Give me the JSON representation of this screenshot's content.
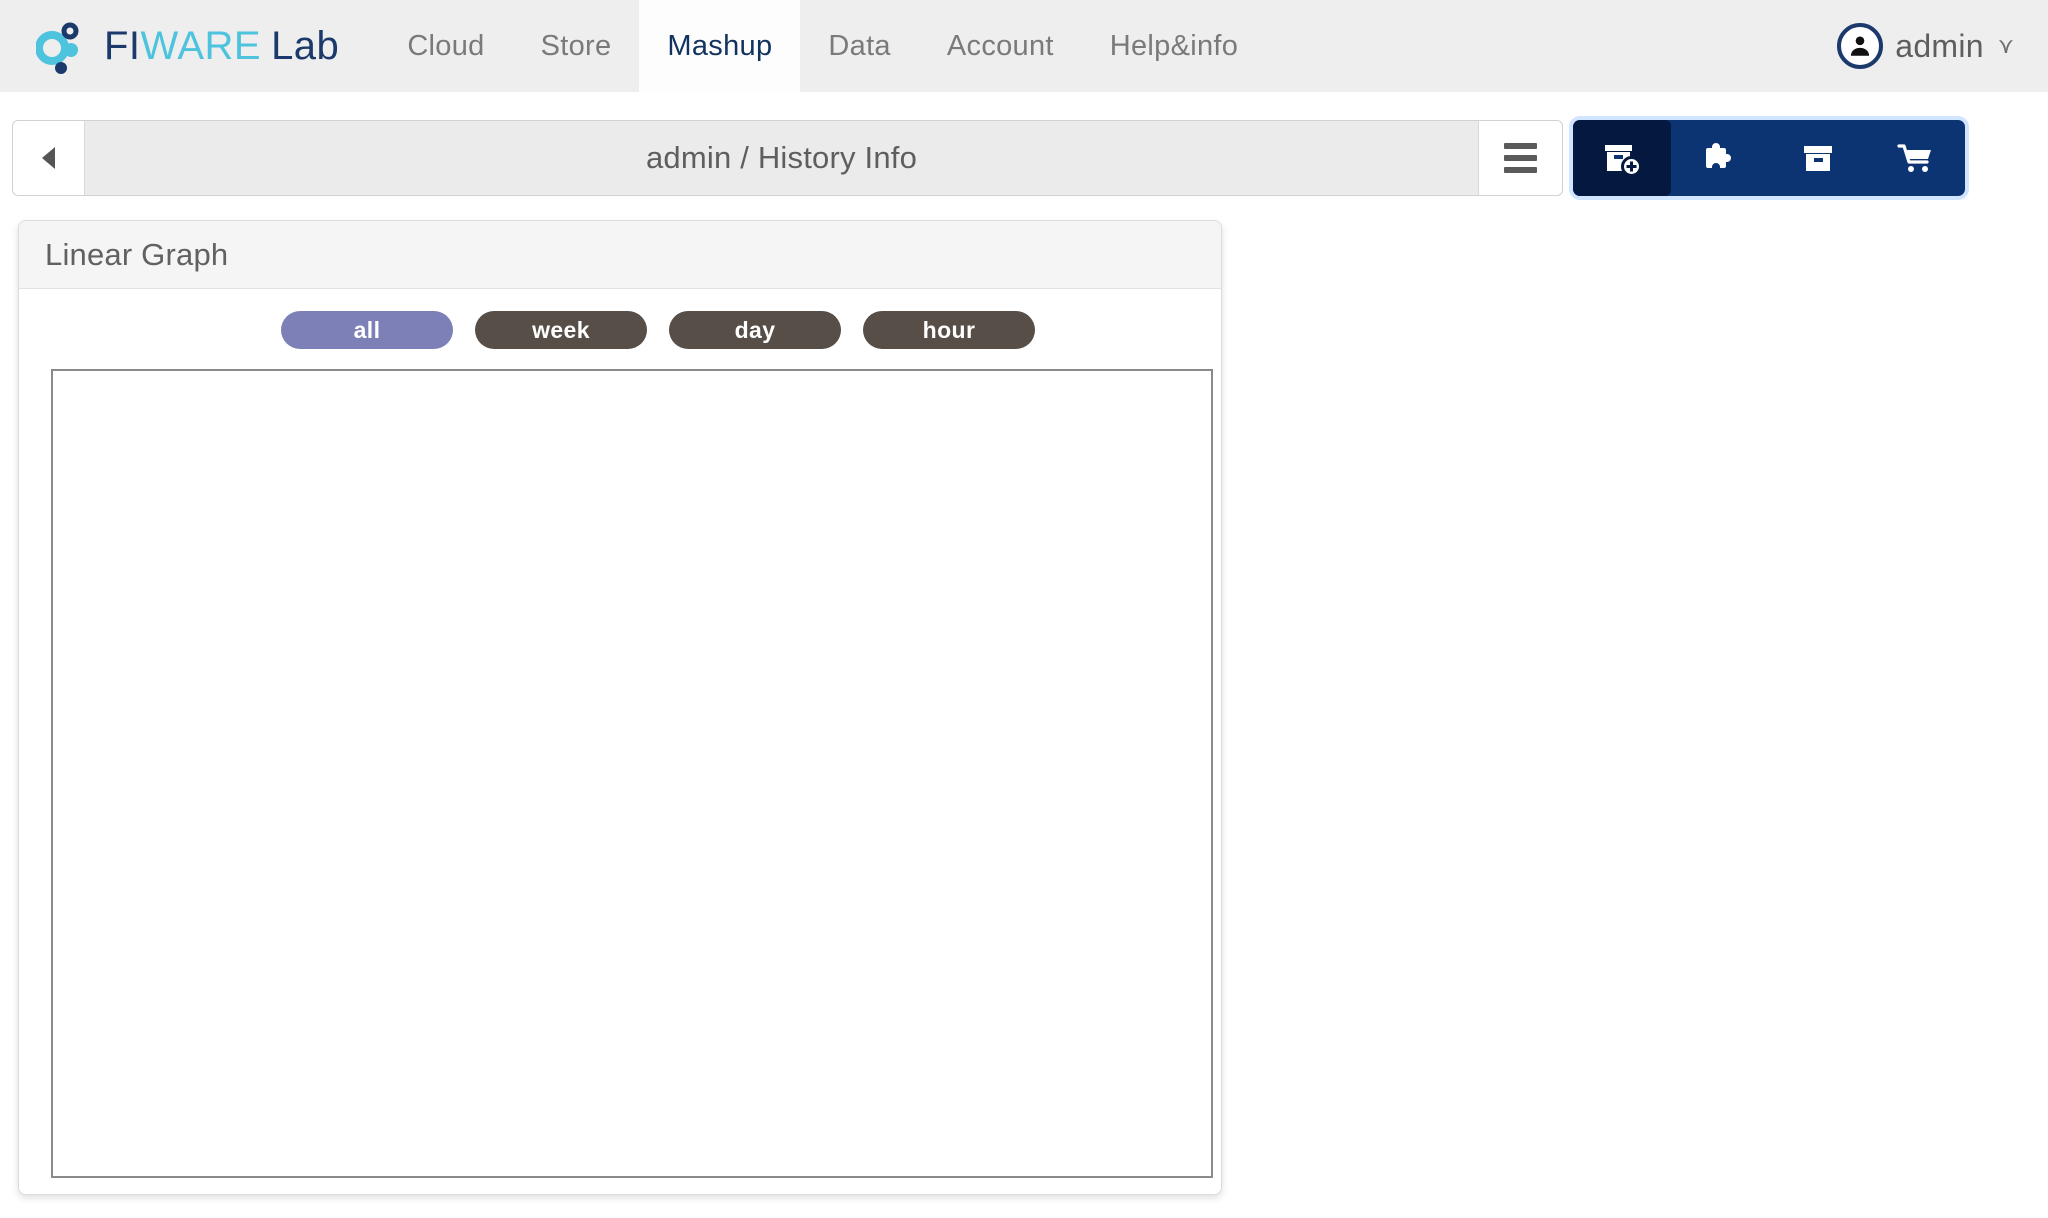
{
  "header": {
    "brand": {
      "fi": "FI",
      "ware": "WARE",
      "lab": "Lab",
      "logo_icon": "fiware-dots-logo"
    },
    "nav": [
      {
        "label": "Cloud",
        "active": false
      },
      {
        "label": "Store",
        "active": false
      },
      {
        "label": "Mashup",
        "active": true
      },
      {
        "label": "Data",
        "active": false
      },
      {
        "label": "Account",
        "active": false
      },
      {
        "label": "Help&info",
        "active": false
      }
    ],
    "user": {
      "name": "admin",
      "avatar_icon": "user-avatar-icon",
      "chevron_icon": "chevron-double-down-icon"
    },
    "background_color": "#eeeeee",
    "active_tab_color": "#12325f"
  },
  "toolbar": {
    "back_icon": "triangle-left-icon",
    "breadcrumb": "admin / History Info",
    "menu_icon": "hamburger-menu-icon",
    "buttons": [
      {
        "name": "new-workspace-button",
        "icon": "box-plus-icon",
        "active": true
      },
      {
        "name": "widgets-button",
        "icon": "puzzle-piece-icon",
        "active": false
      },
      {
        "name": "workspace-button",
        "icon": "archive-box-icon",
        "active": false
      },
      {
        "name": "marketplace-button",
        "icon": "shopping-cart-icon",
        "active": false
      }
    ],
    "accent_color": "#0c3372",
    "active_button_color": "#05183f"
  },
  "widget": {
    "title": "Linear Graph",
    "filters": [
      {
        "label": "all",
        "active": true
      },
      {
        "label": "week",
        "active": false
      },
      {
        "label": "day",
        "active": false
      },
      {
        "label": "hour",
        "active": false
      }
    ],
    "active_filter_color": "#7c80b6",
    "inactive_filter_color": "#564e47",
    "graph_empty": true
  },
  "chart_data": {
    "type": "line",
    "title": "Linear Graph",
    "x": [],
    "series": [],
    "xlabel": "",
    "ylabel": "",
    "grid": false,
    "legend": "none",
    "note": "Graph canvas is empty — no data rendered"
  }
}
